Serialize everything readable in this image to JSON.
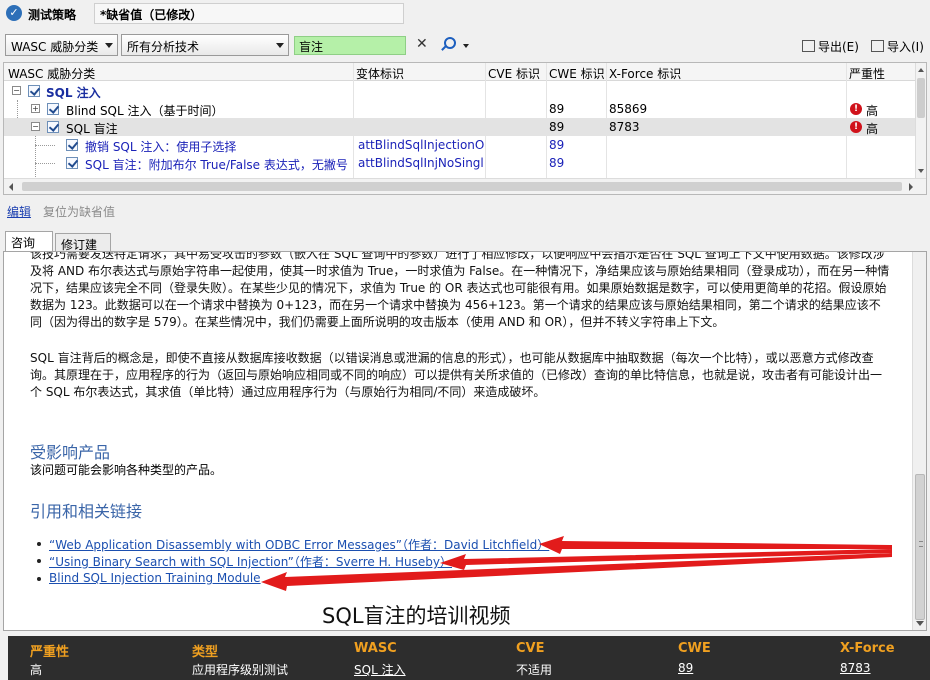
{
  "header": {
    "policy_label": "测试策略",
    "policy_value": "*缺省值（已修改）"
  },
  "toolbar": {
    "classification_select": "WASC 威胁分类",
    "technique_select": "所有分析技术",
    "search_value": "盲注",
    "clear_symbol": "✕",
    "export_label": "导出(E)",
    "import_label": "导入(I)"
  },
  "grid": {
    "columns": [
      "WASC 威胁分类",
      "变体标识",
      "CVE 标识",
      "CWE 标识",
      "X-Force 标识",
      "严重性"
    ],
    "rows": [
      {
        "name": "SQL 注入",
        "variant": "",
        "cve": "",
        "cwe": "",
        "xforce": "",
        "severity": ""
      },
      {
        "name": "Blind SQL 注入（基于时间）",
        "variant": "",
        "cve": "",
        "cwe": "89",
        "xforce": "85869",
        "severity": "高"
      },
      {
        "name": "SQL 盲注",
        "variant": "",
        "cve": "",
        "cwe": "89",
        "xforce": "8783",
        "severity": "高"
      },
      {
        "name": "撤销 SQL 注入：使用子选择",
        "variant": "attBlindSqlInjectionOrd...",
        "cve": "",
        "cwe": "89",
        "xforce": "",
        "severity": ""
      },
      {
        "name": "SQL 盲注：附加布尔 True/False 表达式，无撇号",
        "variant": "attBlindSqlInjNoSingle...",
        "cve": "",
        "cwe": "89",
        "xforce": "",
        "severity": ""
      }
    ]
  },
  "actions": {
    "edit": "编辑",
    "reset": "复位为缺省值"
  },
  "tabs": {
    "description": "咨询",
    "fix": "修订建议"
  },
  "content": {
    "para1": "该技巧需要发送特定请求，其中易受攻击的参数（嵌入在 SQL 查询中的参数）进行了相应修改，以便响应中会指示是否在 SQL 查询上下文中使用数据。该修改涉及将 AND 布尔表达式与原始字符串一起使用，使其一时求值为 True，一时求值为 False。在一种情况下，净结果应该与原始结果相同（登录成功），而在另一种情况下，结果应该完全不同（登录失败）。在某些少见的情况下，求值为 True 的 OR 表达式也可能很有用。如果原始数据是数字，可以使用更简单的花招。假设原始数据为 123。此数据可以在一个请求中替换为 0+123，而在另一个请求中替换为 456+123。第一个请求的结果应该与原始结果相同，第二个请求的结果应该不同（因为得出的数字是 579）。在某些情况中，我们仍需要上面所说明的攻击版本（使用 AND 和 OR），但并不转义字符串上下文。",
    "para2": "SQL 盲注背后的概念是，即使不直接从数据库接收数据（以错误消息或泄漏的信息的形式），也可能从数据库中抽取数据（每次一个比特），或以恶意方式修改查询。其原理在于，应用程序的行为（返回与原始响应相同或不同的响应）可以提供有关所求值的（已修改）查询的单比特信息，也就是说，攻击者有可能设计出一个 SQL 布尔表达式，其求值（单比特）通过应用程序行为（与原始行为相同/不同）来造成破坏。",
    "affected_heading": "受影响产品",
    "affected_text": "该问题可能会影响各种类型的产品。",
    "refs_heading": "引用和相关链接",
    "refs": [
      "“Web Application Disassembly with ODBC Error Messages”（作者：David Litchfield）",
      "“Using Binary Search with SQL Injection”（作者：Sverre H. Huseby）",
      "Blind SQL Injection Training Module"
    ],
    "caption": "SQL盲注的培训视频",
    "arrow_color": "#e21b1b"
  },
  "summary": {
    "headers": [
      "严重性",
      "类型",
      "WASC",
      "CVE",
      "CWE",
      "X-Force"
    ],
    "values": [
      "高",
      "应用程序级别测试",
      "SQL 注入",
      "不适用",
      "89",
      "8783"
    ],
    "header_color": "#f0a020"
  }
}
